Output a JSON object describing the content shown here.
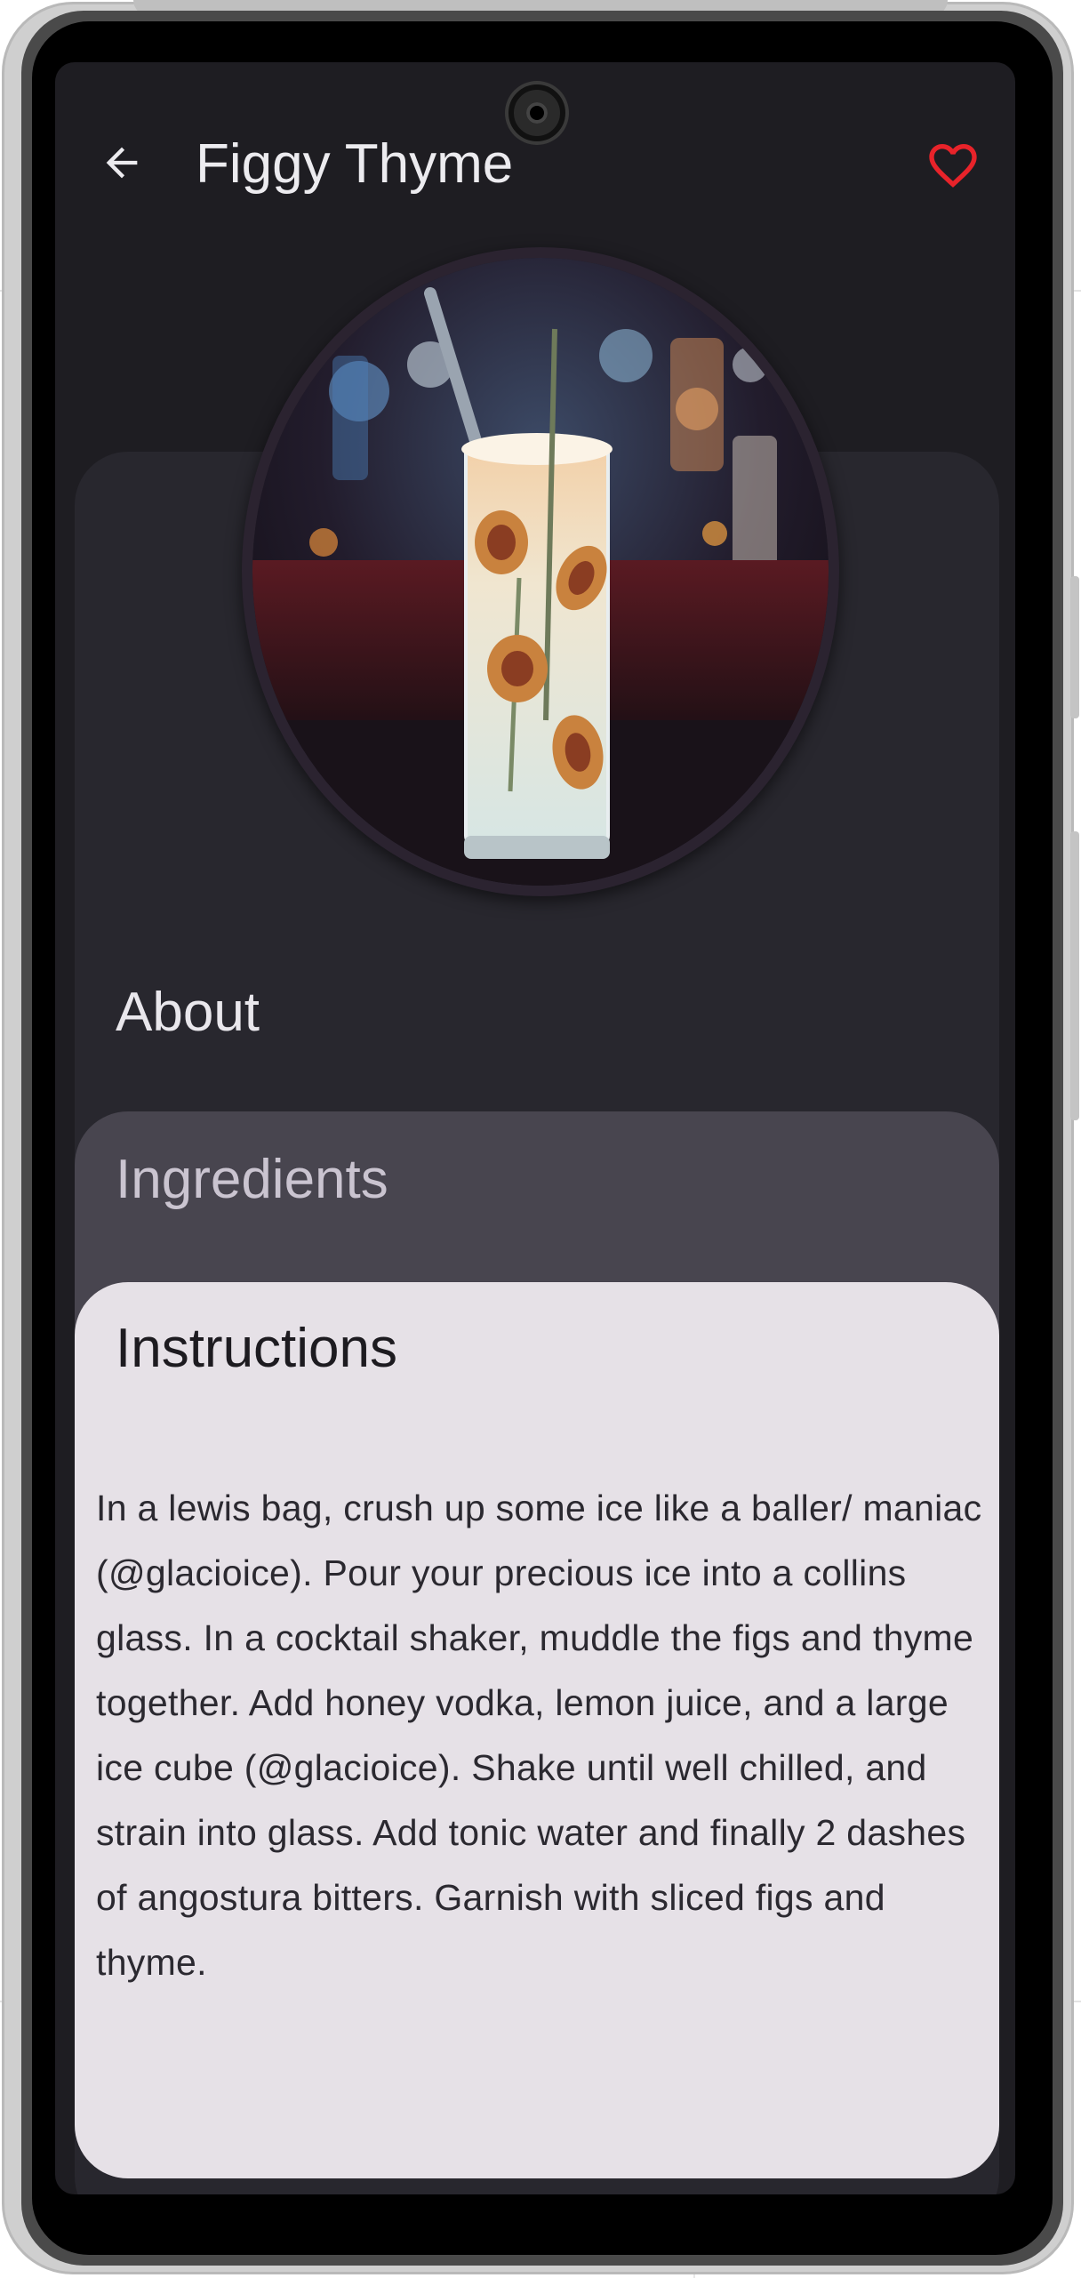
{
  "app_bar": {
    "title": "Figgy Thyme",
    "back_icon": "arrow-left-icon",
    "favorite_icon": "heart-outline-icon",
    "favorite_color": "#e8232a"
  },
  "hero_image": {
    "subject": "cocktail-glass-with-figs-and-thyme"
  },
  "sections": {
    "about_label": "About",
    "ingredients_label": "Ingredients",
    "instructions_label": "Instructions"
  },
  "instructions": {
    "text": "In a lewis bag, crush up some ice like a baller/ maniac (@glacioice). Pour your precious ice into a collins glass. In a cocktail shaker, muddle the figs and thyme together. Add honey vodka, lemon juice, and a large ice cube (@glacioice). Shake until well chilled, and strain into glass. Add tonic water and finally 2 dashes of angostura bitters. Garnish with sliced figs and thyme."
  },
  "colors": {
    "screen_bg": "#1e1d22",
    "about_card": "#28272e",
    "ingredients_card": "#48454f",
    "instructions_card": "#e6e1e7"
  }
}
